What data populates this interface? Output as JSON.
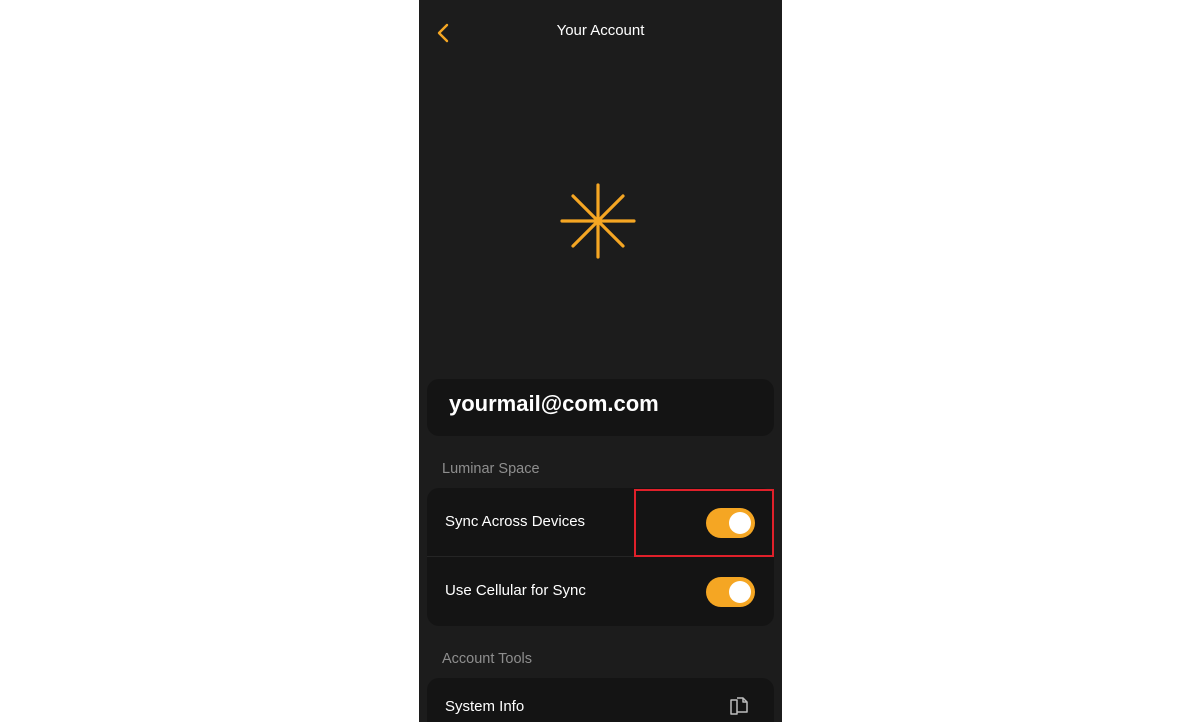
{
  "nav": {
    "title": "Your Account"
  },
  "account": {
    "email": "yourmail@com.com"
  },
  "sections": {
    "luminar_space": {
      "header": "Luminar Space",
      "rows": [
        {
          "label": "Sync Across Devices",
          "toggle_on": true
        },
        {
          "label": "Use Cellular for Sync",
          "toggle_on": true
        }
      ]
    },
    "account_tools": {
      "header": "Account Tools",
      "rows": [
        {
          "label": "System Info",
          "icon": "copy-icon"
        }
      ]
    }
  },
  "colors": {
    "accent": "#f5a623",
    "background": "#1c1c1c",
    "card": "#141414",
    "highlight": "#e0202a"
  },
  "icons": {
    "back": "chevron-left-icon",
    "logo": "luminar-star-icon"
  }
}
